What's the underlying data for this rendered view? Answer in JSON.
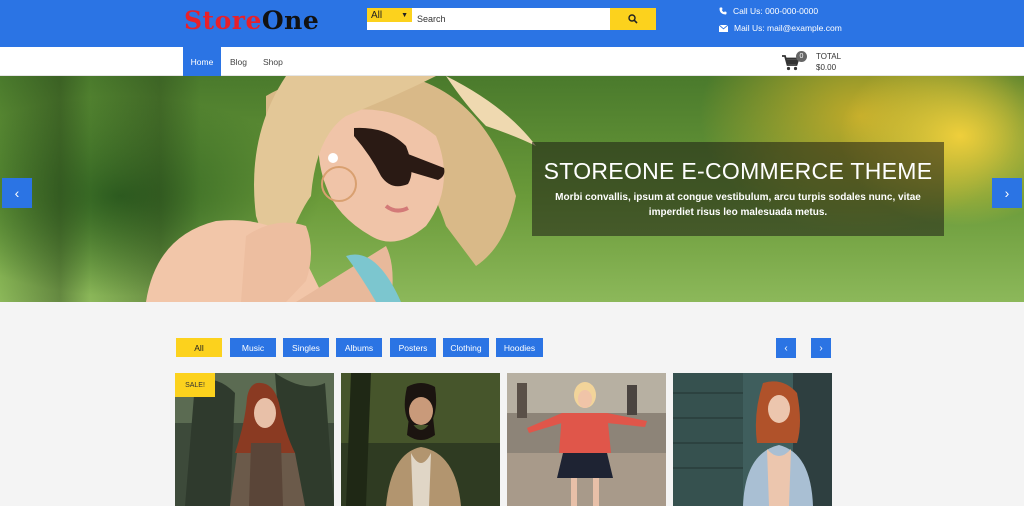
{
  "brand": {
    "part1": "Store",
    "part2": "One"
  },
  "search": {
    "category": "All",
    "placeholder": "Search"
  },
  "contact": {
    "phone": "Call Us: 000-000-0000",
    "mail": "Mail Us: mail@example.com"
  },
  "nav": {
    "items": [
      "Home",
      "Blog",
      "Shop"
    ],
    "active": "Home"
  },
  "cart": {
    "count": "0",
    "total_label": "TOTAL",
    "total_value": "$0.00"
  },
  "hero": {
    "title": "STOREONE E-COMMERCE THEME",
    "text": "Morbi convallis, ipsum at congue vestibulum, arcu turpis sodales nunc, vitae imperdiet risus leo malesuada metus."
  },
  "filters": {
    "items": [
      "All",
      "Music",
      "Singles",
      "Albums",
      "Posters",
      "Clothing",
      "Hoodies"
    ],
    "active": "All"
  },
  "products": {
    "sale_label": "SALE!"
  },
  "colors": {
    "primary": "#2b74e4",
    "accent": "#fcd21d",
    "logo_red": "#e8202a"
  },
  "icons": [
    "caret-down-icon",
    "search-icon",
    "phone-icon",
    "mail-icon",
    "cart-icon",
    "chevron-left-icon",
    "chevron-right-icon"
  ]
}
